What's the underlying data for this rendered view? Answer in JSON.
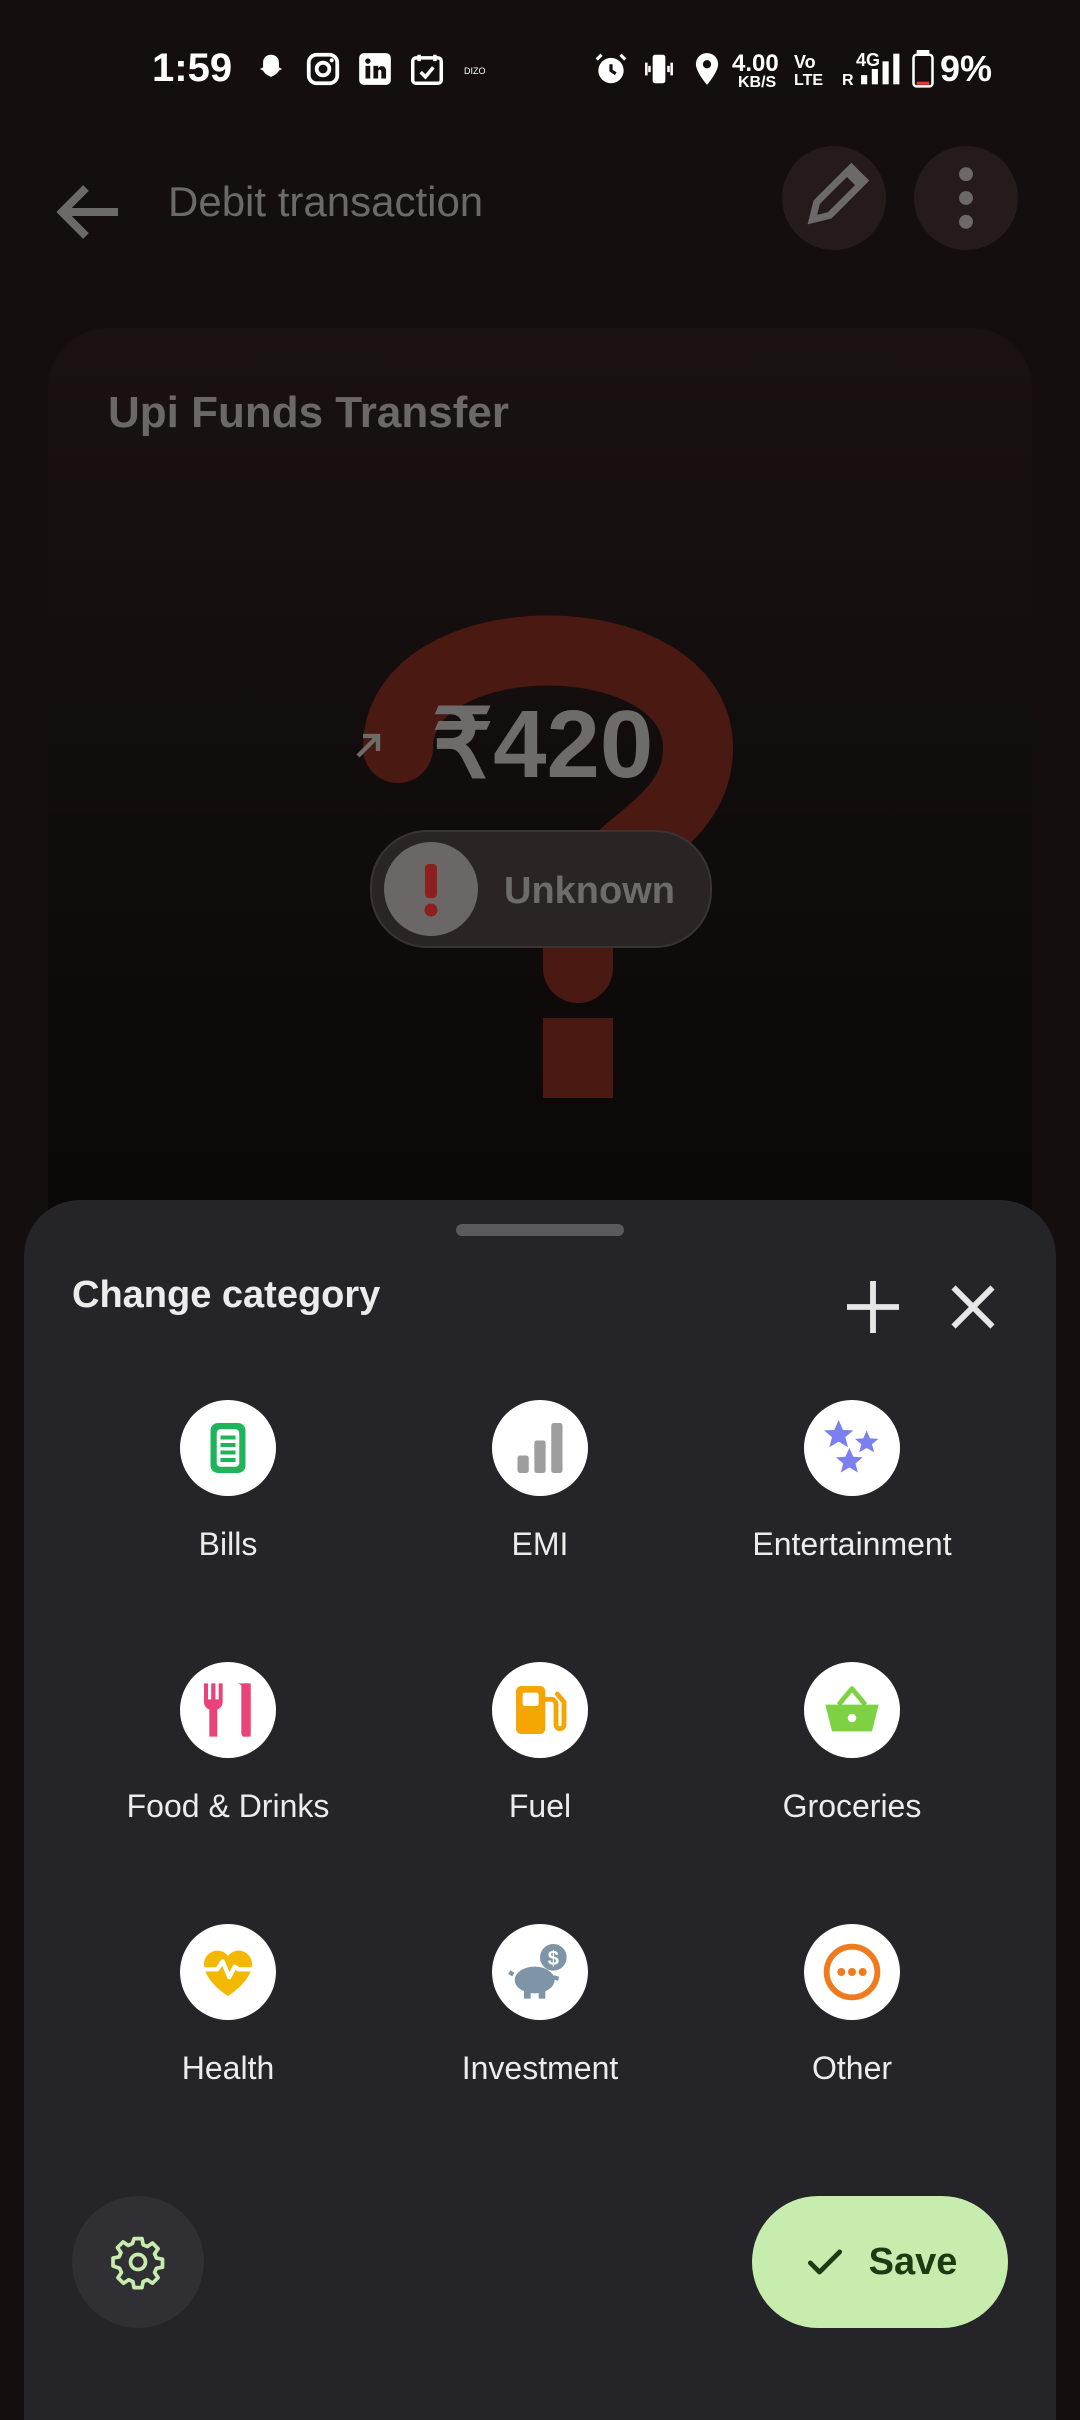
{
  "status_bar": {
    "time": "1:59",
    "speed_value": "4.00",
    "speed_unit": "KB/S",
    "volte": "Vo",
    "volte_sub": "LTE",
    "network": "4G",
    "network_sub": "R",
    "battery": "9%"
  },
  "appbar": {
    "title": "Debit transaction"
  },
  "card": {
    "title": "Upi Funds Transfer",
    "amount": "₹420",
    "status_label": "Unknown"
  },
  "sheet": {
    "title": "Change category",
    "categories": [
      {
        "label": "Bills",
        "icon": "bills-icon",
        "color": "#1fb35a"
      },
      {
        "label": "EMI",
        "icon": "emi-icon",
        "color": "#9e9e9e"
      },
      {
        "label": "Entertainment",
        "icon": "entertainment-icon",
        "color": "#7b7ff0"
      },
      {
        "label": "Food & Drinks",
        "icon": "food-drinks-icon",
        "color": "#e8447a"
      },
      {
        "label": "Fuel",
        "icon": "fuel-icon",
        "color": "#f5a500"
      },
      {
        "label": "Groceries",
        "icon": "groceries-icon",
        "color": "#7dd142"
      },
      {
        "label": "Health",
        "icon": "health-icon",
        "color": "#f5b800"
      },
      {
        "label": "Investment",
        "icon": "investment-icon",
        "color": "#7d95a6"
      },
      {
        "label": "Other",
        "icon": "other-icon",
        "color": "#f07b1e"
      }
    ],
    "save_label": "Save"
  },
  "colors": {
    "accent": "#c6ecae",
    "sheet_bg": "#252428"
  }
}
